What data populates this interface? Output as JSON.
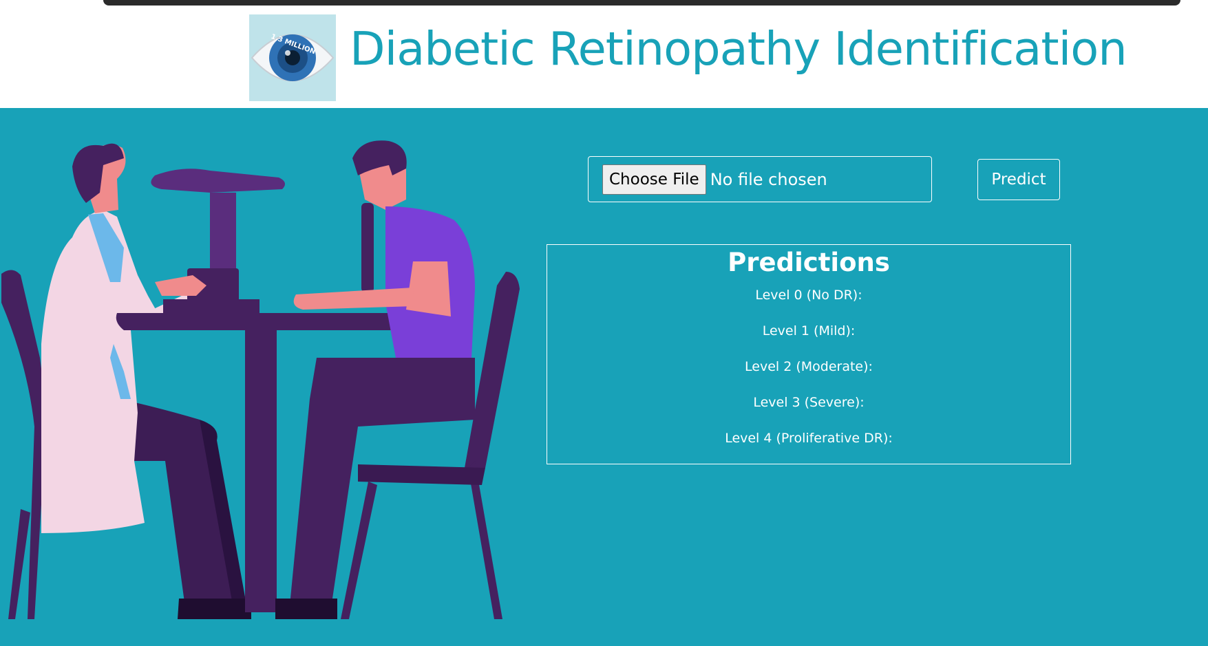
{
  "header": {
    "title": "Diabetic Retinopathy Identification",
    "logo_text": "1.3 MILLION"
  },
  "upload": {
    "choose_label": "Choose File",
    "status_text": "No file chosen"
  },
  "predict_button": "Predict",
  "predictions": {
    "heading": "Predictions",
    "levels": [
      "Level 0 (No DR):",
      "Level 1 (Mild):",
      "Level 2 (Moderate):",
      "Level 3 (Severe):",
      "Level 4 (Proliferative DR):"
    ]
  },
  "colors": {
    "background": "#18a2b8",
    "header_bg": "#ffffff",
    "title_color": "#18a2b8"
  },
  "icons": {
    "logo": "eye-logo-icon",
    "illustration": "eye-exam-illustration"
  }
}
